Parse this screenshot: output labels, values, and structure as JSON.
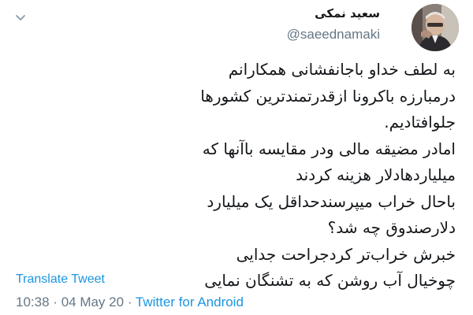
{
  "user": {
    "display_name": "سعید نمکی",
    "handle": "@saeednamaki"
  },
  "tweet": {
    "lines": [
      "به لطف خداو باجانفشانی همکارانم",
      "درمبارزه باکرونا ازقدرتمندترین کشورها",
      "جلوافتادیم.",
      "امادر مضیقه مالی ودر مقایسه باآنها که",
      "میلیاردهادلار هزینه کردند",
      "باحال خراب میپرسندحداقل یک میلیارد",
      "دلارصندوق چه شد؟",
      "خبرش خراب‌تر کردجراحت جدایی",
      "چوخیال آب روشن که به تشنگان نمایی"
    ],
    "translate_label": "Translate Tweet",
    "time": "10:38",
    "date": "04 May 20",
    "separator": "·",
    "source": "Twitter for Android"
  },
  "icons": {
    "menu": "chevron-down-icon",
    "avatar": "profile-photo"
  },
  "colors": {
    "link": "#1b95e0",
    "muted": "#657786",
    "text": "#14171a"
  }
}
